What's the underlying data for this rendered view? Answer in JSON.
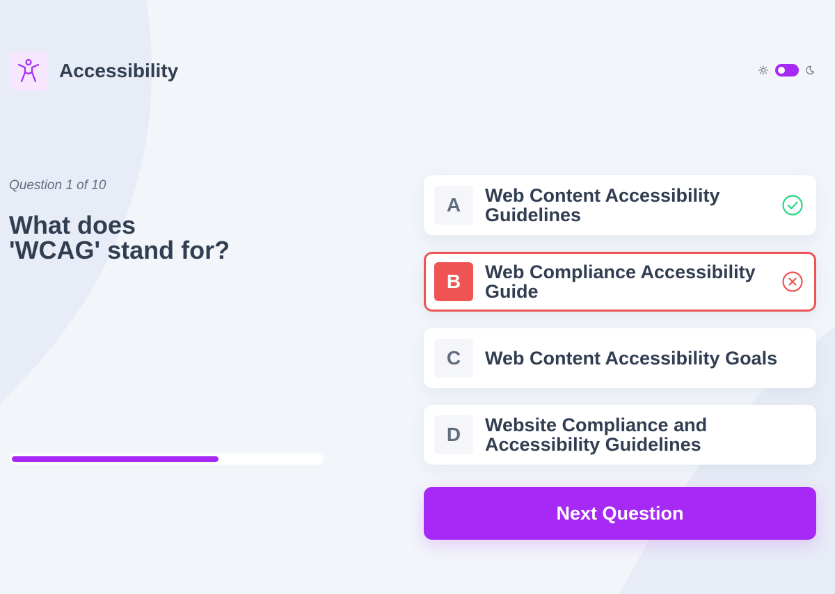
{
  "header": {
    "subject_title": "Accessibility",
    "subject_icon": "accessibility-person-icon"
  },
  "theme_toggle": {
    "mode": "dark",
    "sun_icon": "sun-icon",
    "moon_icon": "moon-icon"
  },
  "quiz": {
    "question_counter": "Question 1 of 10",
    "question_line1": "What does",
    "question_line2": "'WCAG' stand for?",
    "progress_fraction": 0.67
  },
  "options": [
    {
      "letter": "A",
      "text": "Web Content Accessibility Guidelines",
      "status": "correct",
      "status_icon": "check-circle-icon"
    },
    {
      "letter": "B",
      "text": "Web Compliance Accessibility Guide",
      "status": "incorrect-selected",
      "status_icon": "x-circle-icon"
    },
    {
      "letter": "C",
      "text": "Web Content Accessibility Goals",
      "status": "none"
    },
    {
      "letter": "D",
      "text": "Website Compliance and Accessibility Guidelines",
      "status": "none"
    }
  ],
  "next_button_label": "Next Question",
  "colors": {
    "accent": "#a729f5",
    "correct": "#26d782",
    "incorrect": "#ee5454",
    "background": "#f2f5fa",
    "text": "#313e51",
    "muted": "#626c7f"
  }
}
